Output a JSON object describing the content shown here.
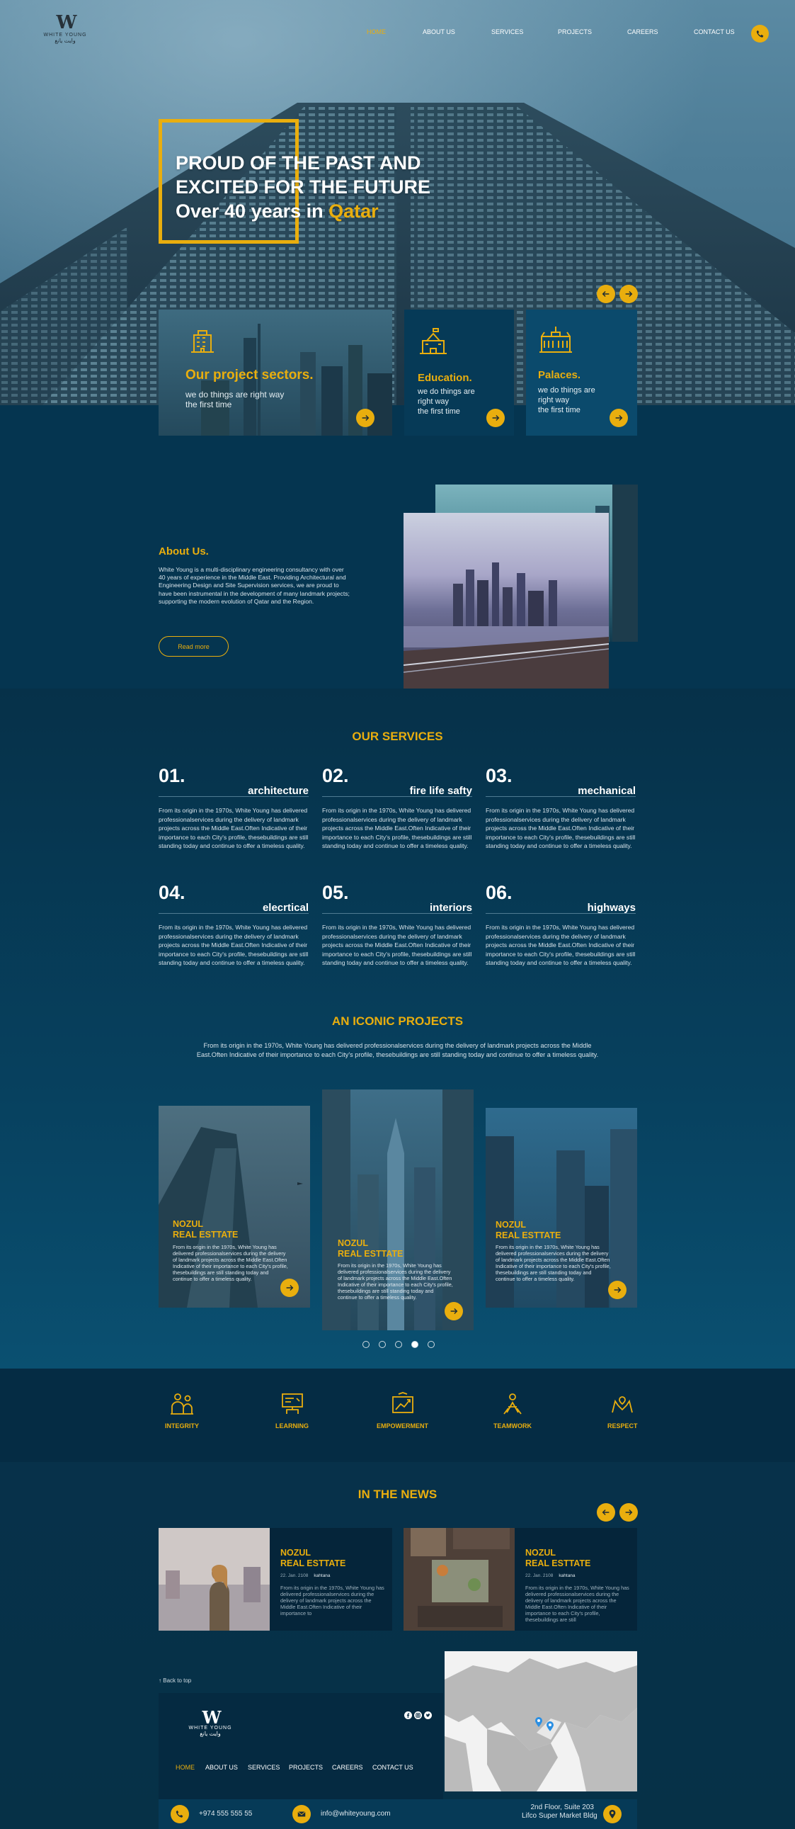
{
  "brand": {
    "name": "WHITE YOUNG",
    "arabic": "وايت يانغ"
  },
  "nav": {
    "items": [
      "HOME",
      "ABOUT US",
      "SERVICES",
      "PROJECTS",
      "CAREERS",
      "CONTACT US"
    ],
    "active": "HOME"
  },
  "hero": {
    "line1": "PROUD OF THE PAST AND",
    "line2": "EXCITED FOR THE FUTURE",
    "line3_prefix": "Over 40 years in ",
    "line3_highlight": "Qatar"
  },
  "sectors": [
    {
      "title": "Our project sectors.",
      "text": [
        "we do things are right way",
        "the first time"
      ],
      "icon": "building-icon"
    },
    {
      "title": "Education.",
      "text": [
        "we do things are",
        "right way",
        "the first time"
      ],
      "icon": "school-icon"
    },
    {
      "title": "Palaces.",
      "text": [
        "we do things are",
        "right way",
        "the first time"
      ],
      "icon": "palace-icon"
    }
  ],
  "about": {
    "title": "About Us.",
    "body": "White Young is a multi-disciplinary engineering consultancy with over 40 years of experience in the Middle East. Providing Architectural and Engineering Design and Site Supervision services, we are proud to have been instrumental in the development of many landmark projects; supporting the modern evolution of Qatar and the Region.",
    "button": "Read more"
  },
  "services": {
    "title": "OUR SERVICES",
    "items": [
      {
        "num": "01.",
        "name": "architecture"
      },
      {
        "num": "02.",
        "name": "fire life safty"
      },
      {
        "num": "03.",
        "name": "mechanical"
      },
      {
        "num": "04.",
        "name": "elecrtical"
      },
      {
        "num": "05.",
        "name": "interiors"
      },
      {
        "num": "06.",
        "name": "highways"
      }
    ],
    "desc": "From its origin in the 1970s, White Young has delivered professionalservices during the delivery of landmark projects across the Middle East.Often Indicative of their importance to each City's profile, thesebuildings are still standing today and continue to offer a timeless quality."
  },
  "projects": {
    "title": "AN ICONIC PROJECTS",
    "intro": "From its origin in the 1970s, White Young has delivered professionalservices during the delivery of landmark projects across the Middle East.Often Indicative of their importance to each City's profile, thesebuildings are still standing today and continue to offer a timeless quality.",
    "cards": [
      {
        "title1": "NOZUL",
        "title2": "REAL ESTTATE"
      },
      {
        "title1": "NOZUL",
        "title2": "REAL ESTTATE"
      },
      {
        "title1": "NOZUL",
        "title2": "REAL ESTTATE"
      }
    ],
    "card_desc": "From its origin in the 1970s, White Young has delivered professionalservices during the delivery of landmark projects across the Middle East.Often Indicative of their importance to each City's profile, thesebuildings are still standing today and continue to offer a timeless quality.",
    "pagination": {
      "count": 5,
      "active": 4
    }
  },
  "values": [
    {
      "label": "INTEGRITY",
      "icon": "integrity-icon"
    },
    {
      "label": "LEARNING",
      "icon": "learning-icon"
    },
    {
      "label": "EMPOWERMENT",
      "icon": "empowerment-icon"
    },
    {
      "label": "TEAMWORK",
      "icon": "teamwork-icon"
    },
    {
      "label": "RESPECT",
      "icon": "respect-icon"
    }
  ],
  "news": {
    "title": "IN THE NEWS",
    "items": [
      {
        "title1": "NOZUL",
        "title2": "REAL ESTTATE",
        "date": "22. Jan. 2108",
        "author": "kahtana",
        "text": "From its origin in the 1970s, White Young has delivered professionalservices during the delivery of landmark projects across the Middle East.Often Indicative of their importance to"
      },
      {
        "title1": "NOZUL",
        "title2": "REAL ESTTATE",
        "date": "22. Jan. 2108",
        "author": "kahtana",
        "text": "From its origin in the 1970s, White Young has delivered professionalservices during the delivery of landmark projects across the Middle East.Often Indicative of their importance to each City's profile, thesebuildings are still"
      }
    ]
  },
  "footer": {
    "back_to_top": "Back to top",
    "nav": [
      "HOME",
      "ABOUT US",
      "SERVICES",
      "PROJECTS",
      "CAREERS",
      "CONTACT US"
    ],
    "phone": "+974 555 555 55",
    "email": "info@whiteyoung.com",
    "address1": "2nd Floor, Suite 203",
    "address2": "Lifco Super Market Bldg"
  },
  "colors": {
    "accent": "#e9ae0e",
    "navy": "#063149",
    "deep": "#052c44"
  }
}
